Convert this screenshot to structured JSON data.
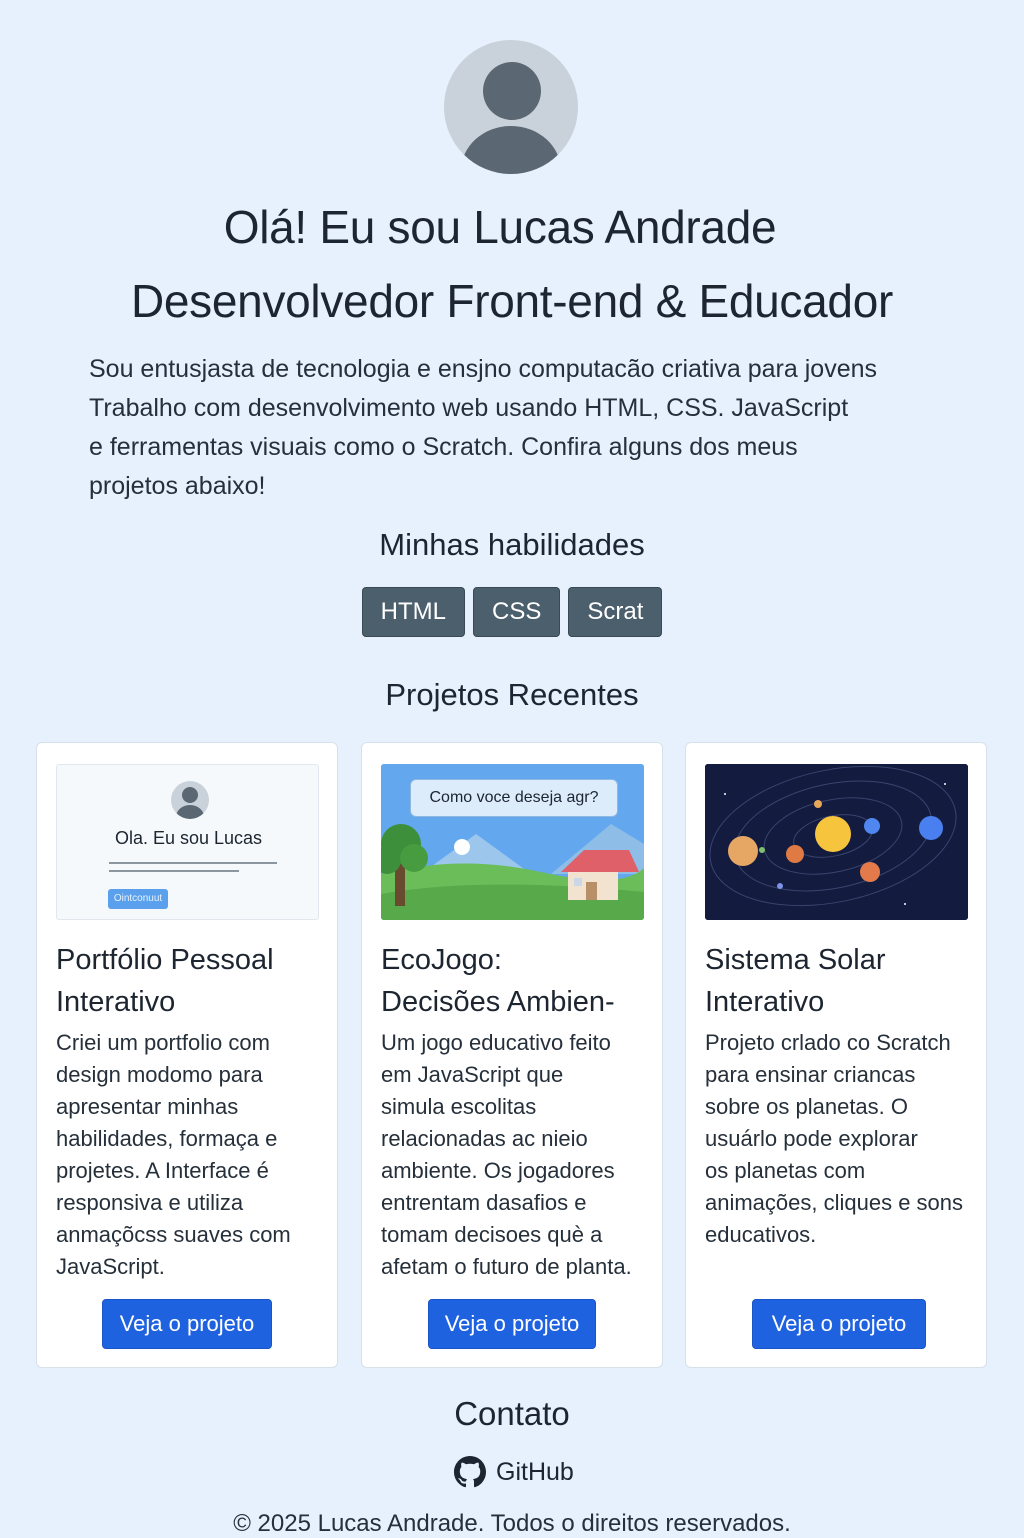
{
  "hero": {
    "title": "Olá! Eu sou Lucas Andrade",
    "subtitle": "Desenvolvedor Front-end & Educador",
    "intro_lines": [
      "Sou entusjasta de tecnologia e ensjno computacão criativa para jovens",
      "Trabalho com desenvolvimento web usando HTML, CSS. JavaScript",
      "e ferramentas visuais como o Scratch. Confira alguns dos meus",
      "projetos abaixo!"
    ]
  },
  "skills": {
    "title": "Minhas habilidades",
    "items": [
      "HTML",
      "CSS",
      "Scrat"
    ]
  },
  "projects": {
    "title": "Projetos Recentes",
    "items": [
      {
        "title_lines": [
          "Portfólio Pessoal",
          "Interativo"
        ],
        "desc_lines": [
          "Criei um portfolio com",
          "design modomo para",
          "apresentar minhas",
          "habilidades, formaça e",
          "projetes. A Interface é",
          "responsiva e utiliza",
          "anmaçõcss suaves com",
          "JavaScript."
        ],
        "button": "Veja o projeto",
        "thumb": {
          "heading": "Ola. Eu sou Lucas",
          "button": "Ointconuut"
        }
      },
      {
        "title_lines": [
          "EcoJogo:",
          "Decisões Ambien-"
        ],
        "desc_lines": [
          "Um jogo educativo feito",
          "em JavaScript que",
          "simula escolitas",
          "relacionadas ac nieio",
          "ambiente. Os jogadores",
          "entrentam dasafios e",
          "tomam decisoes què a",
          "afetam o futuro de planta."
        ],
        "button": "Veja o projeto",
        "thumb": {
          "bubble": "Como voce deseja agr?"
        }
      },
      {
        "title_lines": [
          "Sistema Solar",
          "Interativo"
        ],
        "desc_lines": [
          "Projeto crlado co Scratch",
          "para ensinar criancas",
          "sobre os planetas. O",
          "usuárlo pode explorar",
          "os planetas com",
          "animações, cliques e sons",
          "educativos."
        ],
        "button": "Veja o projeto"
      }
    ]
  },
  "contact": {
    "title": "Contato",
    "github": "GitHub"
  },
  "footer": "© 2025 Lucas Andrade. Todos o direitos reservados."
}
